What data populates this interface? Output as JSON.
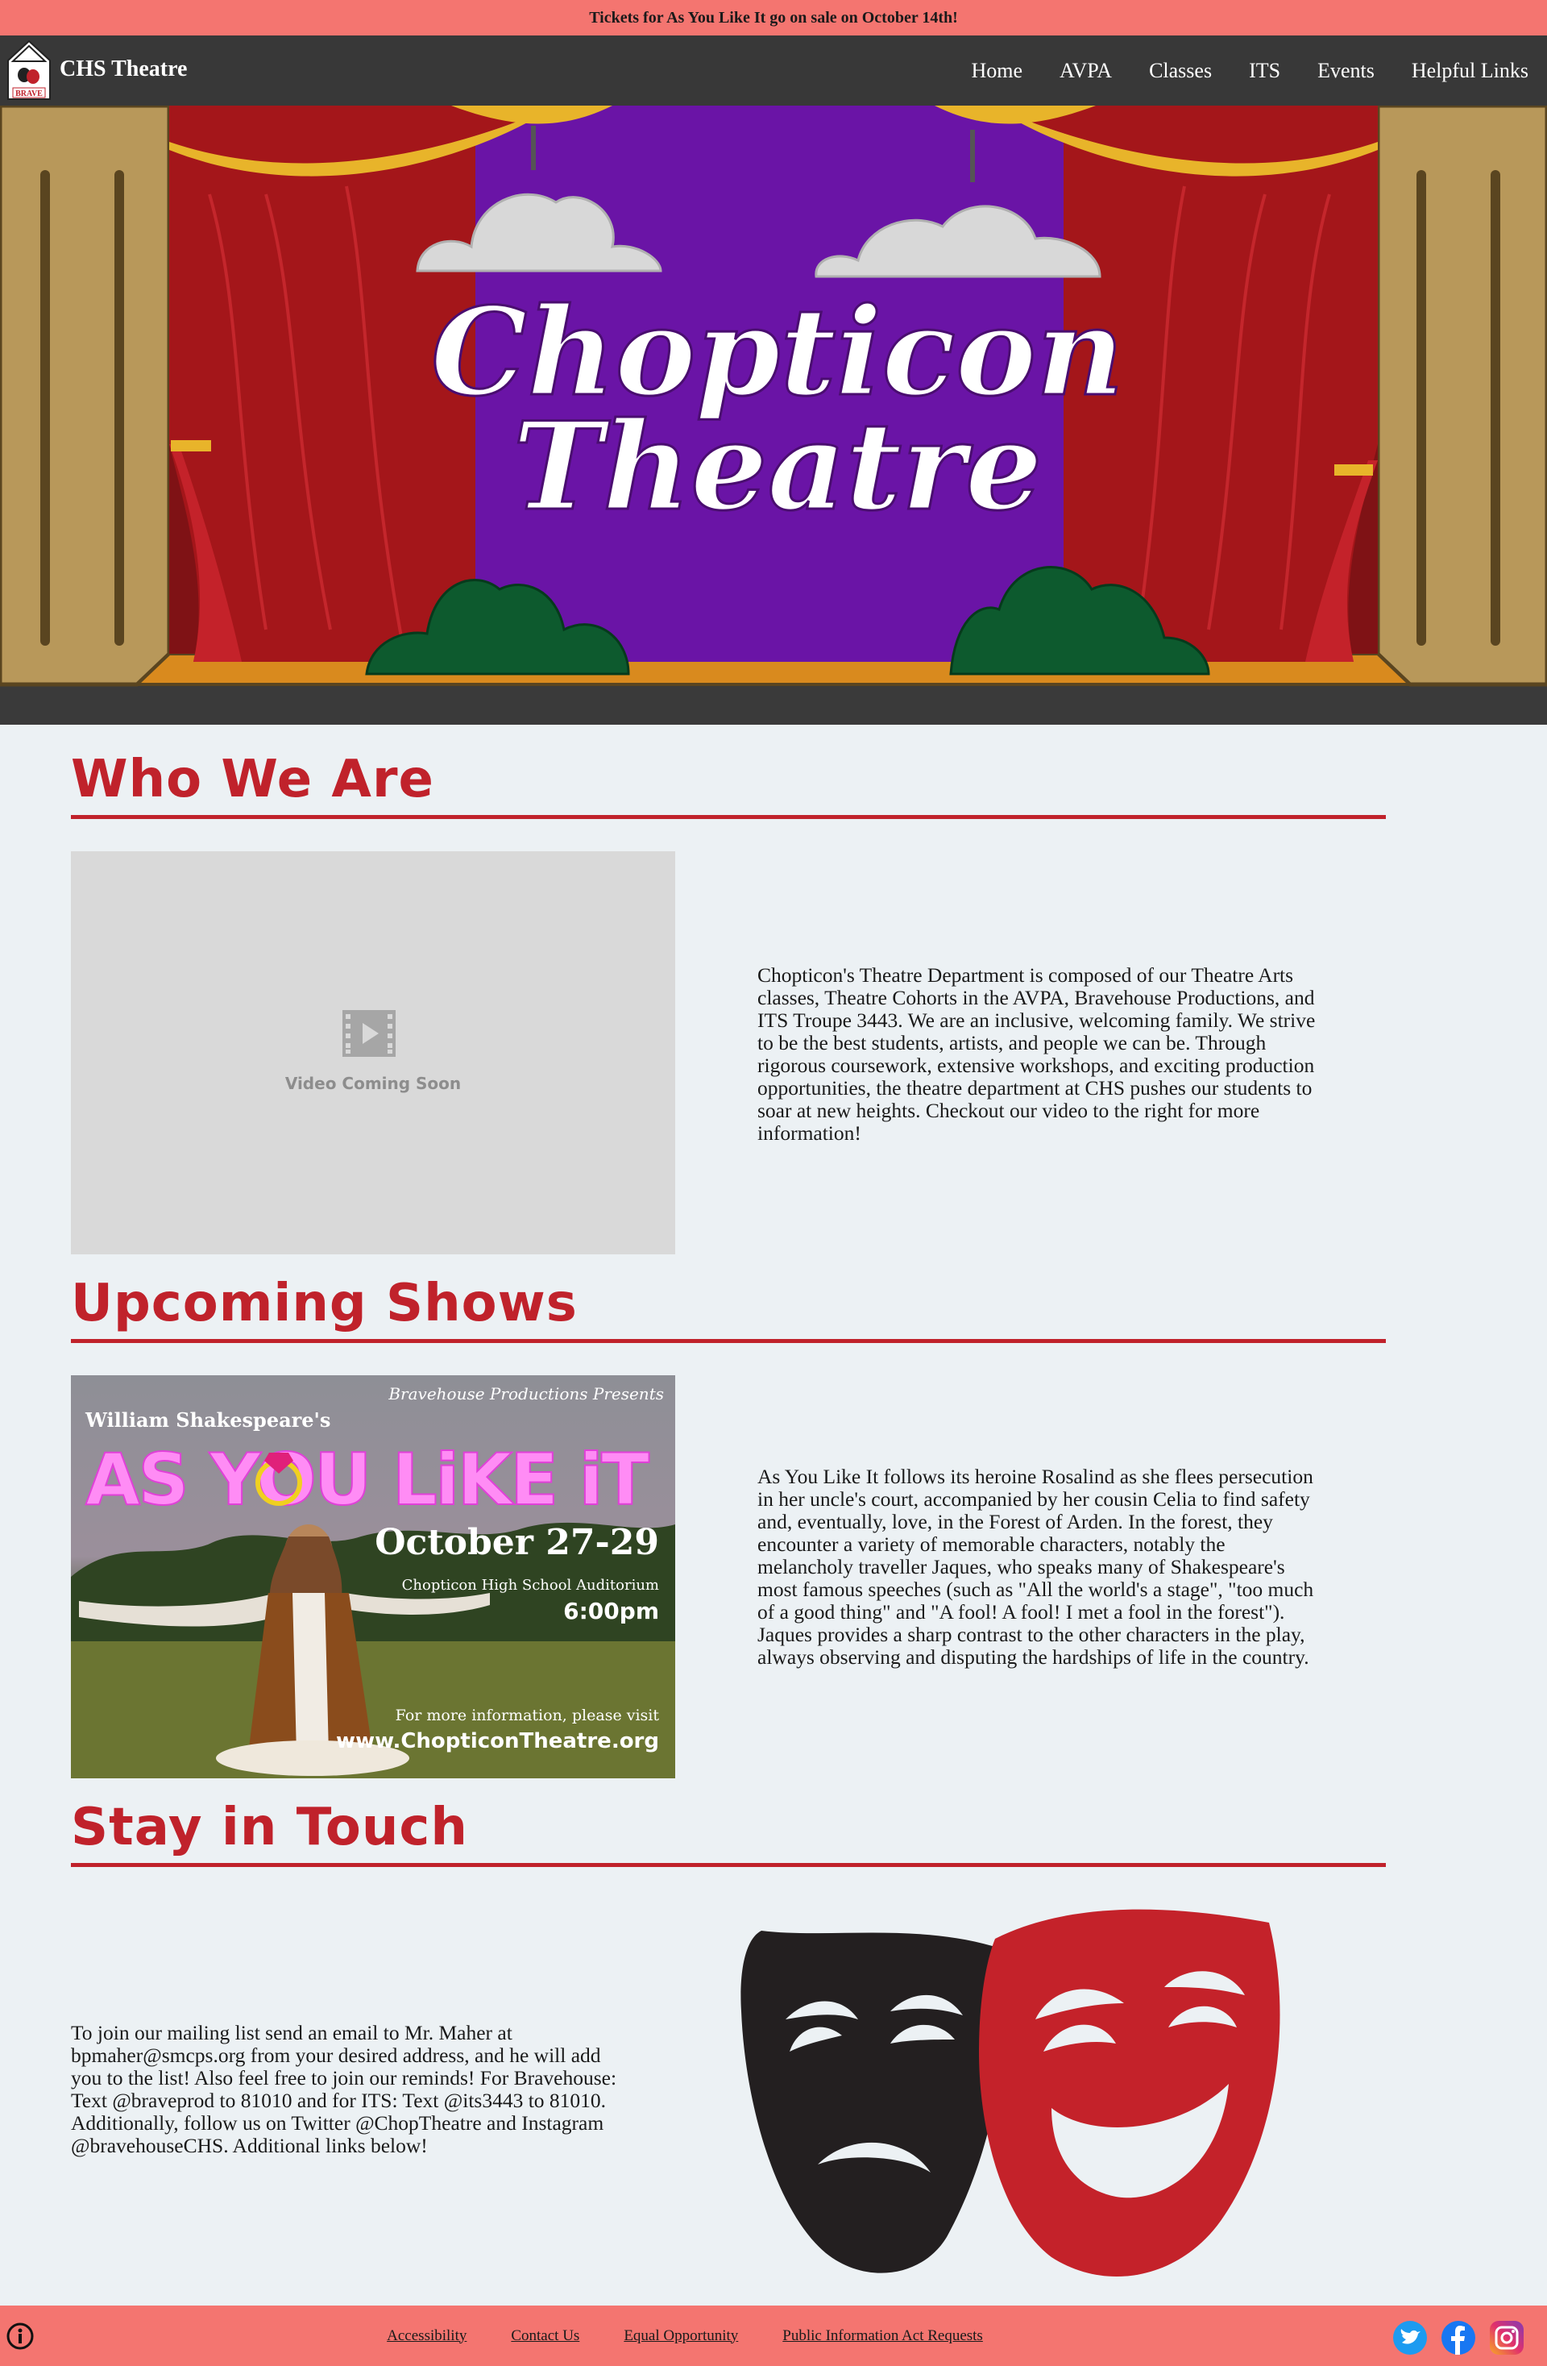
{
  "announcement": "Tickets for As You Like It go on sale on October 14th!",
  "site": {
    "title": "CHS Theatre",
    "logo_text": "BRAVE"
  },
  "nav": [
    "Home",
    "AVPA",
    "Classes",
    "ITS",
    "Events",
    "Helpful Links"
  ],
  "hero": {
    "line1": "Chopticon",
    "line2": "Theatre"
  },
  "sections": {
    "who": {
      "title": "Who We Are",
      "video_text": "Video Coming Soon",
      "text": "Chopticon's Theatre Department is composed of our Theatre Arts classes, Theatre Cohorts in the AVPA, Bravehouse Productions, and ITS Troupe 3443. We are an inclusive, welcoming family. We strive to be the best students, artists, and people we can be. Through rigorous coursework, extensive workshops, and exciting production opportunities, the theatre department at CHS pushes our students to soar at new heights. Checkout our video to the right for more information!"
    },
    "shows": {
      "title": "Upcoming Shows",
      "poster": {
        "presenter": "Bravehouse Productions Presents",
        "author": "William Shakespeare's",
        "show_title": "AS YOU LiKE iT",
        "dates": "October 27-29",
        "venue": "Chopticon High School Auditorium",
        "time": "6:00pm",
        "info": "For more information, please visit",
        "url": "www.ChopticonTheatre.org"
      },
      "text": "As You Like It follows its heroine Rosalind as she flees persecution in her uncle's court, accompanied by her cousin Celia to find safety and, eventually, love, in the Forest of Arden. In the forest, they encounter a variety of memorable characters, notably the melancholy traveller Jaques, who speaks many of Shakespeare's most famous speeches (such as \"All the world's a stage\", \"too much of a good thing\" and \"A fool! A fool! I met a fool in the forest\"). Jaques provides a sharp contrast to the other characters in the play, always observing and disputing the hardships of life in the country."
    },
    "touch": {
      "title": "Stay in Touch",
      "text": "To join our mailing list send an email to Mr. Maher at bpmaher@smcps.org from your desired address, and he will add you to the list! Also feel free to join our reminds! For Bravehouse: Text @braveprod to 81010 and for ITS: Text @its3443 to 81010. Additionally, follow us on Twitter @ChopTheatre and Instagram @bravehouseCHS. Additional links below!"
    }
  },
  "footer": {
    "links": [
      "Accessibility",
      "Contact Us",
      "Equal Opportunity",
      "Public Information Act Requests"
    ],
    "social": [
      "twitter-icon",
      "facebook-icon",
      "instagram-icon"
    ]
  },
  "colors": {
    "accent_red": "#c0222b",
    "banner": "#f47570",
    "nav_bg": "#383838",
    "page_bg": "#ecf1f4",
    "stage_purple": "#6a14a6",
    "curtain_red": "#a4161a",
    "frame_gold": "#b8985a"
  }
}
